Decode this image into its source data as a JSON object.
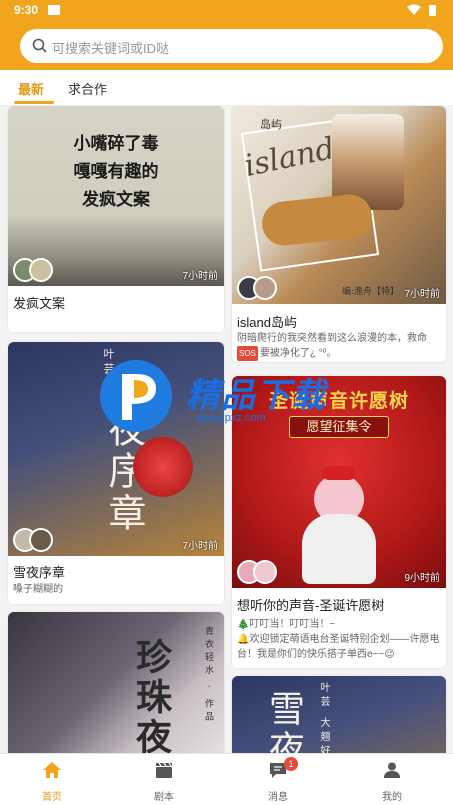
{
  "status": {
    "time": "9:30"
  },
  "search": {
    "placeholder": "可搜索关键词或ID哒"
  },
  "tabs": [
    {
      "label": "最新"
    },
    {
      "label": "求合作"
    }
  ],
  "cards": [
    {
      "time": "7小时前",
      "title": "发疯文案",
      "cover_text": "小嘴碎了毒\n嘎嘎有趣的\n发疯文案"
    },
    {
      "time": "7小时前",
      "title": "island岛屿",
      "desc": "阴暗爬行的我突然看到这么浪漫的本，救命",
      "desc2": "要被净化了¿ °º。",
      "badge": "🆘",
      "cover_word": "island",
      "cover_small": "岛屿",
      "cover_bottom": "编:渔舟【特】"
    },
    {
      "time": "7小时前",
      "title": "雪夜序章",
      "sub": "嗓子糊糊的",
      "cover_big": "雪夜序章",
      "cover_small": "叶芸"
    },
    {
      "time": "9小时前",
      "title": "想听你的声音-圣诞许愿树",
      "line1": "🎄叮叮当！叮叮当！~",
      "line2": "🔔欢迎锁定萌语电台圣诞特别企划——许愿电台！我是你们的快乐搭子单西e~~😉",
      "banner_top": "圣诞声音许愿树",
      "banner_sub": "愿望征集令"
    },
    {
      "cover_big": "珍珠夜",
      "cover_small": "青衣轻水 · 作品"
    },
    {
      "cover_big": "雪夜",
      "cover_small": "叶芸 大翘好"
    }
  ],
  "watermark": {
    "title": "精品下载",
    "url": "www.jpxz.com"
  },
  "nav": [
    {
      "label": "首页"
    },
    {
      "label": "剧本"
    },
    {
      "label": "消息",
      "badge": "1"
    },
    {
      "label": "我的"
    }
  ],
  "colors": {
    "accent": "#f1a51d",
    "accent_text": "#e69a1a",
    "badge": "#e84a3a"
  }
}
